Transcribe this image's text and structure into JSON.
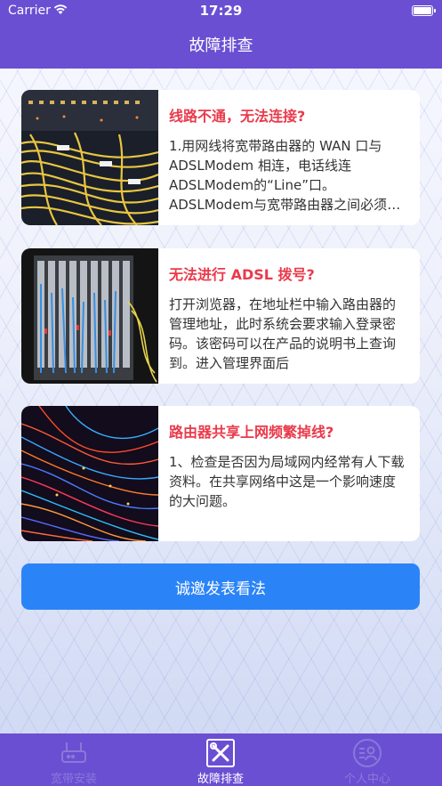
{
  "status_bar": {
    "carrier": "Carrier",
    "time": "17:29"
  },
  "nav": {
    "title": "故障排查"
  },
  "cards": [
    {
      "title": "线路不通，无法连接?",
      "body": "1.用网线将宽带路由器的 WAN 口与 ADSLModem 相连，电话线连 ADSLModem的“Line”口。 ADSLModem与宽带路由器之间必须使用",
      "image": "network-cables-photo"
    },
    {
      "title": "无法进行 ADSL 拨号?",
      "body": "打开浏览器，在地址栏中输入路由器的管理地址，此时系统会要求输入登录密码。该密码可以在产品的说明书上查询到。进入管理界面后",
      "image": "server-rack-photo"
    },
    {
      "title": "路由器共享上网频繁掉线?",
      "body": "1、检查是否因为局域网内经常有人下载资料。在共享网络中这是一个影响速度的大问题。",
      "image": "fiber-optic-photo"
    }
  ],
  "cta": {
    "label": "诚邀发表看法"
  },
  "tabbar": {
    "tabs": [
      {
        "label": "宽带安装",
        "icon": "router-icon",
        "active": false
      },
      {
        "label": "故障排查",
        "icon": "tools-icon",
        "active": true
      },
      {
        "label": "个人中心",
        "icon": "user-center-icon",
        "active": false
      }
    ]
  },
  "colors": {
    "accent": "#6a4fd3",
    "title_red": "#ea3a4b",
    "button_blue": "#2b84f7"
  }
}
